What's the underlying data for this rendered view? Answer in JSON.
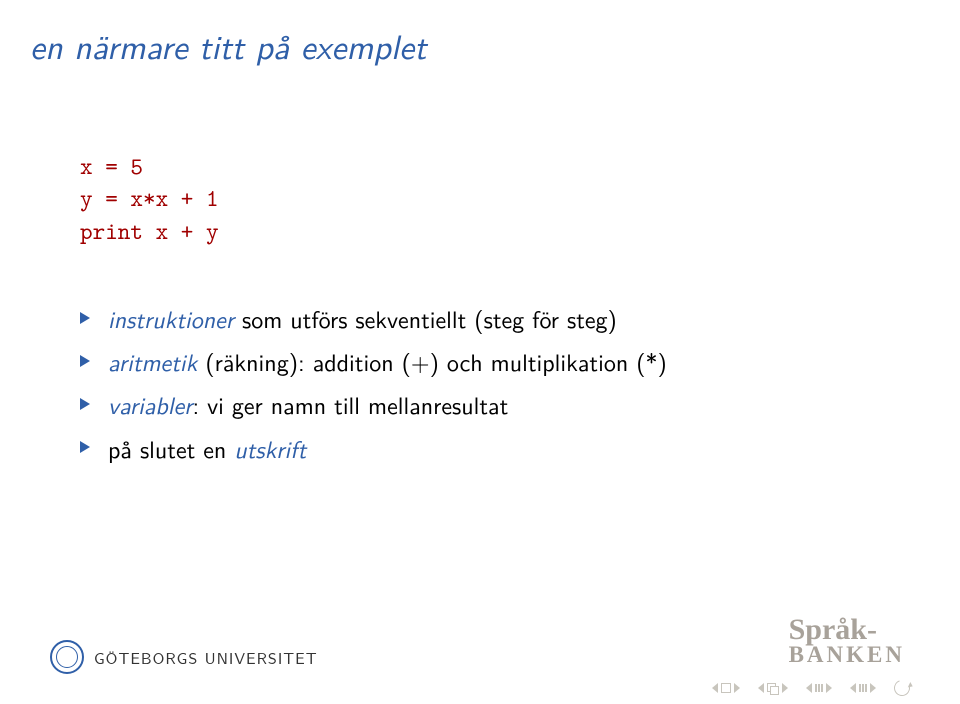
{
  "title": "en närmare titt på exemplet",
  "code": "x = 5\ny = x*x + 1\nprint x + y",
  "bullets": [
    {
      "term": "instruktioner",
      "rest": " som utförs sekventiellt (steg för steg)"
    },
    {
      "term": "aritmetik",
      "rest": " (räkning): addition (+) och multiplikation (*)"
    },
    {
      "term": "variabler",
      "rest": ": vi ger namn till mellanresultat"
    },
    {
      "term": "",
      "rest": "på slutet en ",
      "term2": "utskrift"
    }
  ],
  "footer": {
    "university": "GÖTEBORGS UNIVERSITET",
    "sprak_top": "Språk-",
    "sprak_bot": "BANKEN"
  }
}
